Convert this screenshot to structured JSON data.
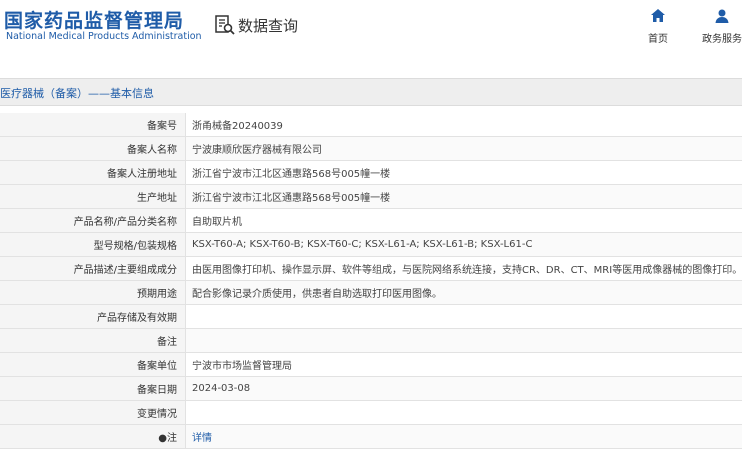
{
  "header": {
    "logo_cn": "国家药品监督管理局",
    "logo_en": "National Medical Products Administration",
    "query_label": "数据查询",
    "nav": {
      "home": "首页",
      "gov": "政务服务"
    }
  },
  "section": {
    "title": "医疗器械（备案）——基本信息"
  },
  "rows": [
    {
      "label": "备案号",
      "value": "浙甬械备20240039"
    },
    {
      "label": "备案人名称",
      "value": "宁波康顺欣医疗器械有限公司"
    },
    {
      "label": "备案人注册地址",
      "value": "浙江省宁波市江北区通惠路568号005幢一楼"
    },
    {
      "label": "生产地址",
      "value": "浙江省宁波市江北区通惠路568号005幢一楼"
    },
    {
      "label": "产品名称/产品分类名称",
      "value": "自助取片机"
    },
    {
      "label": "型号规格/包装规格",
      "value": "KSX-T60-A; KSX-T60-B; KSX-T60-C; KSX-L61-A; KSX-L61-B; KSX-L61-C"
    },
    {
      "label": "产品描述/主要组成成分",
      "value": "由医用图像打印机、操作显示屏、软件等组成，与医院网络系统连接，支持CR、DR、CT、MRI等医用成像器械的图像打印。"
    },
    {
      "label": "预期用途",
      "value": "配合影像记录介质使用，供患者自助选取打印医用图像。"
    },
    {
      "label": "产品存储及有效期",
      "value": ""
    },
    {
      "label": "备注",
      "value": ""
    },
    {
      "label": "备案单位",
      "value": "宁波市市场监督管理局"
    },
    {
      "label": "备案日期",
      "value": "2024-03-08"
    },
    {
      "label": "变更情况",
      "value": ""
    },
    {
      "label": "●注",
      "value": "详情"
    }
  ]
}
